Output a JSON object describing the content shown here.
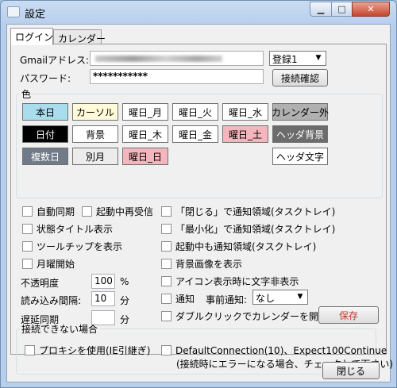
{
  "window": {
    "title": "設定",
    "minimize_symbol": "▁",
    "maximize_symbol": "□",
    "close_symbol": "✕"
  },
  "tabs": [
    {
      "label": "ログイン"
    },
    {
      "label": "カレンダー"
    }
  ],
  "account": {
    "gmail_label": "Gmailアドレス:",
    "gmail_value": "",
    "account_select": "登録1",
    "password_label": "パスワード:",
    "password_value": "***********",
    "connect_button": "接続確認"
  },
  "colors": {
    "group_label": "色",
    "buttons": [
      {
        "label": "本日",
        "bg": "#a9dcec",
        "fg": "#000000"
      },
      {
        "label": "カーソル",
        "bg": "#fffad7",
        "fg": "#000000"
      },
      {
        "label": "曜日_月",
        "bg": "#ffffff",
        "fg": "#000000"
      },
      {
        "label": "曜日_火",
        "bg": "#ffffff",
        "fg": "#000000"
      },
      {
        "label": "曜日_水",
        "bg": "#ffffff",
        "fg": "#000000"
      },
      {
        "label": "カレンダー外",
        "bg": "#b0b0b0",
        "fg": "#000000"
      },
      {
        "label": "日付",
        "bg": "#000000",
        "fg": "#ffffff"
      },
      {
        "label": "背景",
        "bg": "#ffffff",
        "fg": "#000000"
      },
      {
        "label": "曜日_木",
        "bg": "#ffffff",
        "fg": "#000000"
      },
      {
        "label": "曜日_金",
        "bg": "#ffffff",
        "fg": "#000000"
      },
      {
        "label": "曜日_土",
        "bg": "#f4b6bd",
        "fg": "#000000"
      },
      {
        "label": "ヘッダ背景",
        "bg": "#6c6c6c",
        "fg": "#ffffff"
      },
      {
        "label": "複数日",
        "bg": "#707a88",
        "fg": "#ffffff"
      },
      {
        "label": "別月",
        "bg": "#ececec",
        "fg": "#000000"
      },
      {
        "label": "曜日_日",
        "bg": "#f4b6bd",
        "fg": "#000000"
      },
      {
        "label": "ヘッダ文字",
        "bg": "#ffffff",
        "fg": "#000000"
      }
    ]
  },
  "options_left": {
    "auto_sync": "自動同期",
    "resync_on_start": "起動中再受信",
    "show_status_title": "状態タイトル表示",
    "show_tooltip": "ツールチップを表示",
    "monday_start": "月曜開始",
    "opacity_label": "不透明度",
    "opacity_value": "100",
    "opacity_unit": "%",
    "read_interval_label": "読み込み間隔:",
    "read_interval_value": "10",
    "read_interval_unit": "分",
    "delay_sync_label": "遅延同期",
    "delay_sync_value": "",
    "delay_sync_unit": "分"
  },
  "options_right": {
    "close_to_tray": "「閉じる」で通知領域(タスクトレイ)",
    "minimize_to_tray": "「最小化」で通知領域(タスクトレイ)",
    "tray_while_running": "起動中も通知領域(タスクトレイ)",
    "show_bg_image": "背景画像を表示",
    "hide_text_with_icon": "アイコン表示時に文字非表示",
    "notify": "通知",
    "advance_notice_label": "事前通知:",
    "advance_notice_value": "なし",
    "double_click_open": "ダブルクリックでカレンダーを開く"
  },
  "save_button": "保存",
  "connection": {
    "group_label": "接続できない場合",
    "proxy": "プロキシを使用(IE引継ぎ)",
    "default_conn": "DefaultConnection(10)、Expect100Continue",
    "default_conn_note": "(接続時にエラーになる場合、チェックして下さい)"
  },
  "close_button": "閉じる"
}
